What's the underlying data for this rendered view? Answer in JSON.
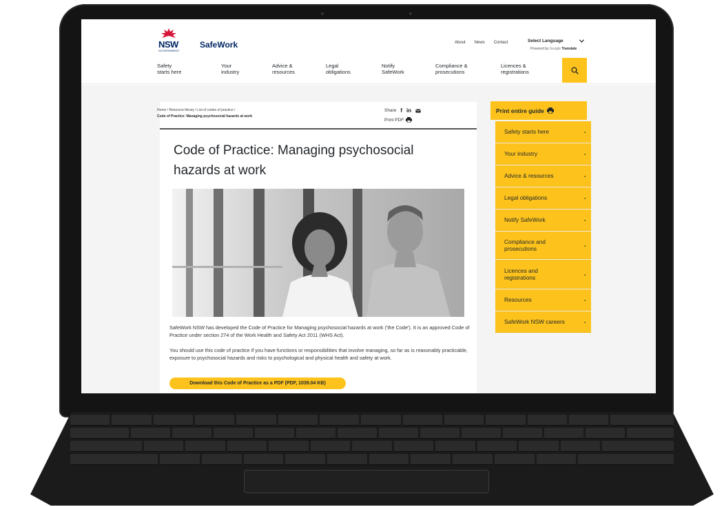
{
  "logo": {
    "primary": "NSW",
    "secondary": "GOVERNMENT"
  },
  "brand": "SafeWork",
  "utility_links": [
    "About",
    "News",
    "Contact"
  ],
  "language": {
    "selected": "Select Language",
    "powered_prefix": "Powered by",
    "powered_google": "Google",
    "powered_translate": "Translate"
  },
  "main_nav": [
    {
      "line1": "Safety",
      "line2": "starts here"
    },
    {
      "line1": "Your",
      "line2": "industry"
    },
    {
      "line1": "Advice &",
      "line2": "resources"
    },
    {
      "line1": "Legal",
      "line2": "obligations"
    },
    {
      "line1": "Notify",
      "line2": "SafeWork"
    },
    {
      "line1": "Compliance &",
      "line2": "prosecutions"
    },
    {
      "line1": "Licences &",
      "line2": "registrations"
    }
  ],
  "breadcrumb": {
    "home": "Home",
    "library": "Resource library",
    "codes": "List of codes of practice",
    "sep": "/",
    "current": "Code of Practice: Managing psychosocial hazards at work"
  },
  "share": {
    "label": "Share",
    "print_pdf": "Print PDF"
  },
  "title": "Code of Practice: Managing psychosocial hazards at work",
  "paragraphs": [
    "SafeWork NSW has developed the Code of Practice for Managing psychosocial hazards at work ('the Code'). It is an approved Code of Practice under section 274 of the Work Health and Safety Act 2011 (WHS Act).",
    "You should use this code of practice if you have functions or responsibilities that involve managing, so far as is reasonably practicable, exposure to psychosocial hazards and risks to psychological and physical health and safety at work."
  ],
  "download_label": "Download this Code of Practice as a PDF (PDF, 1039.04 KB)",
  "guide": {
    "print_label": "Print entire guide"
  },
  "side_nav": [
    "Safety starts here",
    "Your industry",
    "Advice & resources",
    "Legal obligations",
    "Notify SafeWork",
    "Compliance and prosecutions",
    "Licences and registrations",
    "Resources",
    "SafeWork NSW careers"
  ],
  "colors": {
    "accent": "#fdc31c",
    "brand": "#002664",
    "logo_red": "#d7153a",
    "text": "#22272b"
  },
  "icons": {
    "search": "search-icon",
    "facebook": "facebook-icon",
    "linkedin": "linkedin-icon",
    "email": "email-icon",
    "print": "printer-icon",
    "chevron": "chevron-down-icon"
  }
}
